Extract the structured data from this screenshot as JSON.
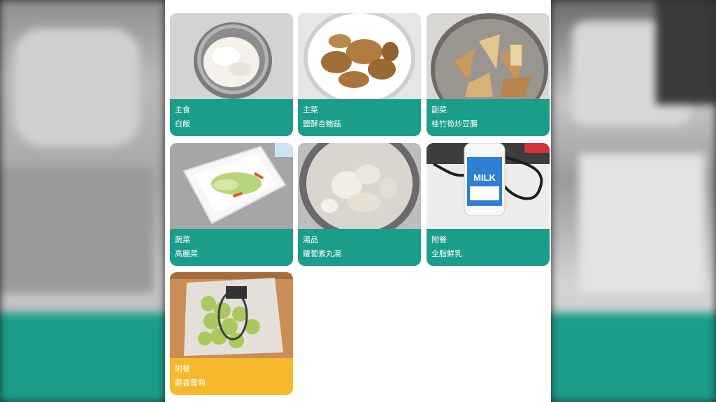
{
  "menu": {
    "items": [
      {
        "category": "主食",
        "name": "白飯",
        "icon": "rice-bowl-photo"
      },
      {
        "category": "主菜",
        "name": "鹽酥杏鮑菇",
        "icon": "fried-mushroom-photo"
      },
      {
        "category": "副菜",
        "name": "桂竹筍炒豆腸",
        "icon": "bamboo-shoot-photo"
      },
      {
        "category": "蔬菜",
        "name": "高麗菜",
        "icon": "cabbage-photo"
      },
      {
        "category": "湯品",
        "name": "蘿蔔素丸湯",
        "icon": "radish-soup-photo"
      },
      {
        "category": "附餐",
        "name": "全脂鮮乳",
        "icon": "milk-bottle-photo"
      },
      {
        "category": "附餐",
        "name": "麝香葡萄",
        "icon": "grapes-photo"
      }
    ],
    "milk_bottle_text": "MILK",
    "colors": {
      "teal": "#1a9e8a",
      "yellow": "#f6b92b",
      "panel": "#ffffff"
    }
  }
}
